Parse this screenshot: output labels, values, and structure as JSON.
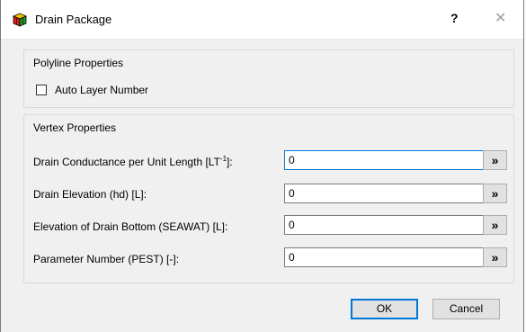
{
  "window": {
    "title": "Drain Package",
    "help_label": "?",
    "close_label": "✕"
  },
  "polyline_group": {
    "title": "Polyline Properties",
    "auto_layer_label": "Auto Layer Number",
    "auto_layer_checked": false
  },
  "vertex_group": {
    "title": "Vertex Properties",
    "rows": [
      {
        "label_pre": "Drain Conductance per Unit Length [LT",
        "label_sup": "-1",
        "label_post": "]:",
        "value": "0",
        "button": "»"
      },
      {
        "label": "Drain Elevation (hd) [L]:",
        "value": "0",
        "button": "»"
      },
      {
        "label": "Elevation of Drain Bottom (SEAWAT) [L]:",
        "value": "0",
        "button": "»"
      },
      {
        "label": "Parameter Number (PEST) [-]:",
        "value": "0",
        "button": "»"
      }
    ]
  },
  "buttons": {
    "ok": "OK",
    "cancel": "Cancel"
  }
}
